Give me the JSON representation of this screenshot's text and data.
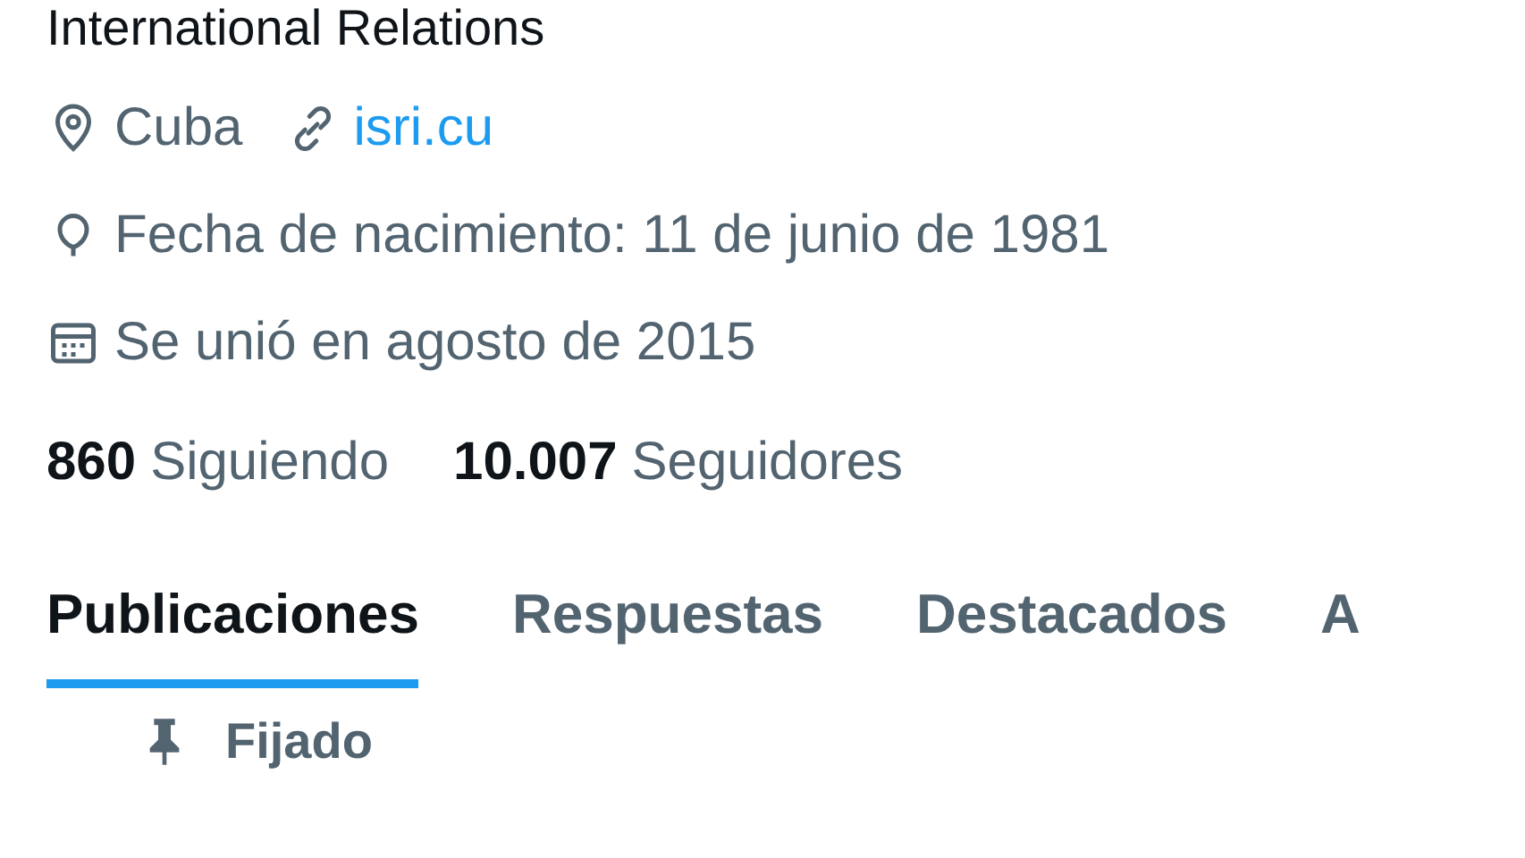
{
  "bio_tail": "International Relations",
  "details": [
    {
      "kind": "location",
      "text": "Cuba"
    },
    {
      "kind": "link",
      "text": "isri.cu"
    }
  ],
  "birth": {
    "kind": "birthday",
    "text": "Fecha de nacimiento: 11 de junio de 1981"
  },
  "joined": {
    "kind": "calendar",
    "text": "Se unió en agosto de 2015"
  },
  "stats": [
    {
      "count": "860",
      "label": "Siguiendo"
    },
    {
      "count": "10.007",
      "label": "Seguidores"
    }
  ],
  "tabs": [
    {
      "label": "Publicaciones",
      "selected": true
    },
    {
      "label": "Respuestas",
      "selected": false
    },
    {
      "label": "Destacados",
      "selected": false
    },
    {
      "label": "A",
      "selected": false
    }
  ],
  "pinned": {
    "label": "Fijado"
  }
}
